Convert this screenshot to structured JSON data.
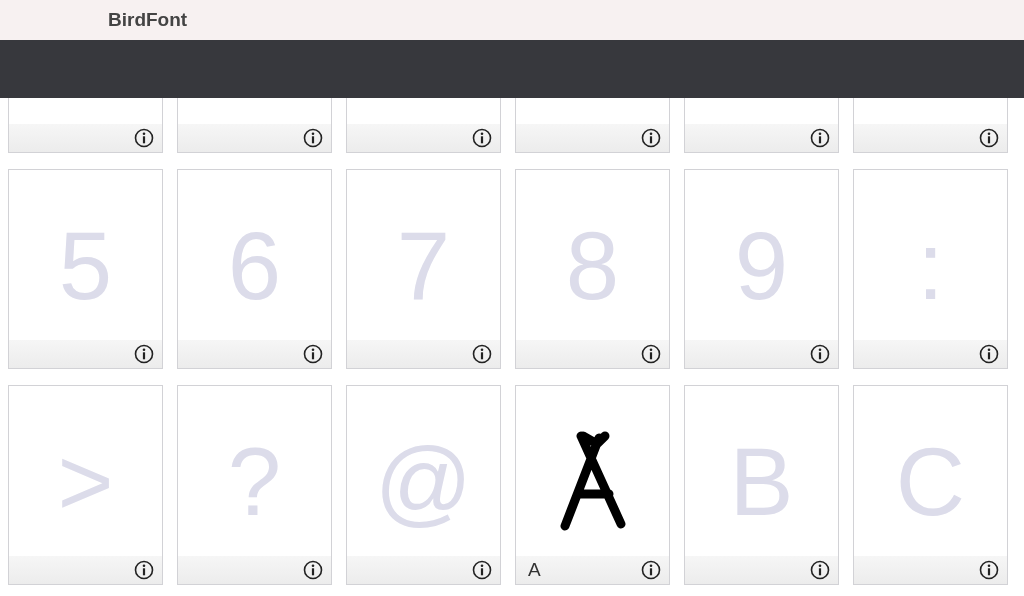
{
  "window": {
    "title": "BirdFont"
  },
  "glyphs": [
    {
      "kind": "empty"
    },
    {
      "kind": "empty"
    },
    {
      "kind": "empty"
    },
    {
      "kind": "empty"
    },
    {
      "kind": "empty"
    },
    {
      "kind": "empty"
    },
    {
      "kind": "placeholder",
      "glyph": "5"
    },
    {
      "kind": "placeholder",
      "glyph": "6"
    },
    {
      "kind": "placeholder",
      "glyph": "7"
    },
    {
      "kind": "placeholder",
      "glyph": "8"
    },
    {
      "kind": "placeholder",
      "glyph": "9"
    },
    {
      "kind": "placeholder",
      "glyph": ":"
    },
    {
      "kind": "placeholder",
      "glyph": ">"
    },
    {
      "kind": "placeholder",
      "glyph": "?"
    },
    {
      "kind": "placeholder",
      "glyph": "@"
    },
    {
      "kind": "drawn",
      "label": "A"
    },
    {
      "kind": "placeholder",
      "glyph": "B"
    },
    {
      "kind": "placeholder",
      "glyph": "C"
    }
  ]
}
